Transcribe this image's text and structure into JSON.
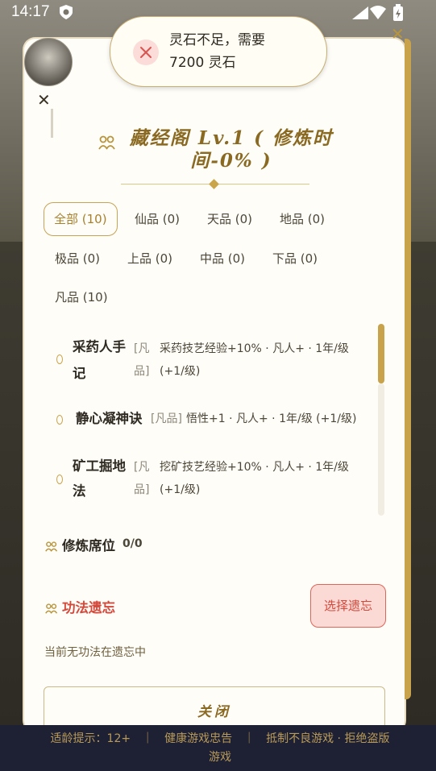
{
  "status": {
    "time": "14:17"
  },
  "toast": {
    "line1": "灵石不足，需要",
    "line2": "7200 灵石"
  },
  "title": "藏经阁 Lv.1 ( 修炼时间-0% )",
  "filters": [
    {
      "label": "全部 (10)",
      "active": true
    },
    {
      "label": "仙品 (0)"
    },
    {
      "label": "天品 (0)"
    },
    {
      "label": "地品 (0)"
    },
    {
      "label": "极品 (0)"
    },
    {
      "label": "上品 (0)"
    },
    {
      "label": "中品 (0)"
    },
    {
      "label": "下品 (0)"
    },
    {
      "label": "凡品 (10)"
    }
  ],
  "techniques": [
    {
      "name_l1": "采药人手",
      "name_l2": "记",
      "grade_l1": "[凡",
      "grade_l2": "品]",
      "desc_l1": "采药技艺经验+10% · 凡人+ · 1年/级",
      "desc_l2": "(+1/级)"
    },
    {
      "name": "静心凝神诀",
      "grade": "[凡品]",
      "desc": "悟性+1 · 凡人+ · 1年/级 (+1/级)"
    },
    {
      "name_l1": "矿工掘地",
      "name_l2": "法",
      "grade_l1": "[凡",
      "grade_l2": "品]",
      "desc_l1": "挖矿技艺经验+10% · 凡人+ · 1年/级",
      "desc_l2": "(+1/级)"
    }
  ],
  "seats": {
    "label": "修炼席位",
    "count": "0/0"
  },
  "forget": {
    "label": "功法遗忘",
    "button": "选择遗忘",
    "empty": "当前无功法在遗忘中"
  },
  "close_button": "关闭",
  "footer": {
    "line1": "适龄提示：12+　｜　健康游戏忠告　｜　抵制不良游戏 · 拒绝盗版",
    "line2": "游戏"
  },
  "colors": {
    "gold": "#c9a24c",
    "accent_red": "#d34a3c",
    "footer_bg": "#1e2033"
  },
  "icons": [
    "shield-icon",
    "wifi-icon",
    "signal-icon",
    "battery-icon",
    "close-icon",
    "people-icon",
    "diamond-icon"
  ]
}
